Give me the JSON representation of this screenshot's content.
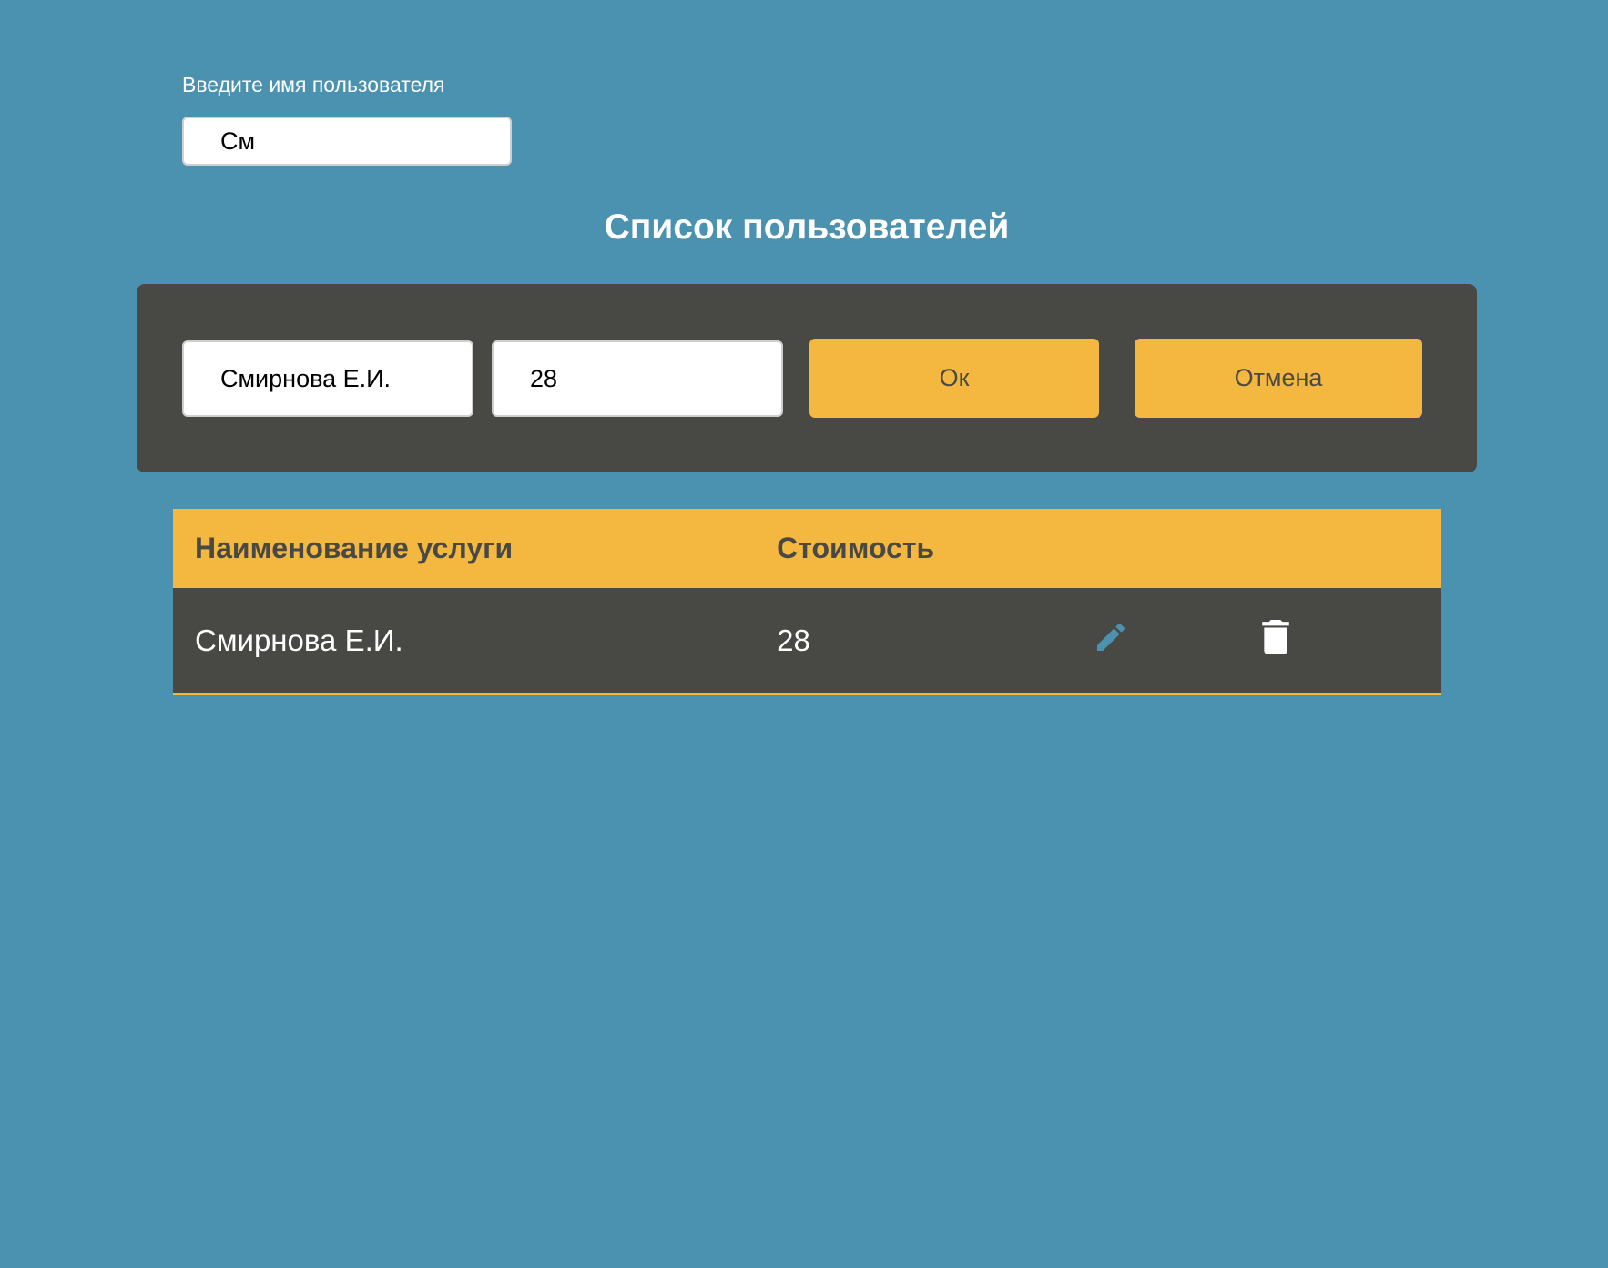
{
  "search": {
    "label": "Введите имя пользователя",
    "value": "См"
  },
  "page": {
    "title": "Список пользователей"
  },
  "edit_form": {
    "name_value": "Смирнова Е.И.",
    "cost_value": "28",
    "ok_label": "Ок",
    "cancel_label": "Отмена"
  },
  "table": {
    "headers": {
      "name": "Наименование услуги",
      "cost": "Стоимость"
    },
    "rows": [
      {
        "name": "Смирнова Е.И.",
        "cost": "28",
        "edit_icon": "pencil-icon",
        "delete_icon": "trash-icon"
      }
    ]
  },
  "colors": {
    "background": "#4a92b0",
    "panel": "#484844",
    "accent": "#f4b73f",
    "edit_icon": "#4a92b0",
    "delete_icon": "#ffffff"
  }
}
